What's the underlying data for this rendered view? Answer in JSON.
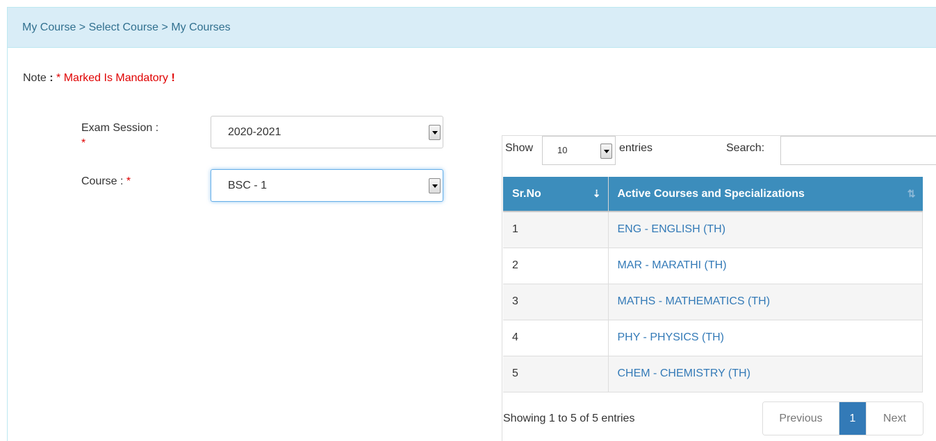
{
  "breadcrumb": "My Course > Select Course > My Courses",
  "note": {
    "prefix": "Note",
    "colon": ":",
    "asterisk": "*",
    "text": "Marked Is Mandatory",
    "bang": "!"
  },
  "form": {
    "exam_session_label": "Exam Session :",
    "exam_session_value": "2020-2021",
    "course_label": "Course :",
    "course_value": "BSC - 1",
    "required_mark": "*"
  },
  "datatable": {
    "show_label": "Show",
    "page_length": "10",
    "entries_label": "entries",
    "search_label": "Search:",
    "search_value": "",
    "columns": [
      "Sr.No",
      "Active Courses and Specializations"
    ],
    "rows": [
      {
        "sr": "1",
        "course": "ENG - ENGLISH (TH)"
      },
      {
        "sr": "2",
        "course": "MAR - MARATHI (TH)"
      },
      {
        "sr": "3",
        "course": "MATHS - MATHEMATICS (TH)"
      },
      {
        "sr": "4",
        "course": "PHY - PHYSICS (TH)"
      },
      {
        "sr": "5",
        "course": "CHEM - CHEMISTRY (TH)"
      }
    ],
    "info": "Showing 1 to 5 of 5 entries",
    "pagination": {
      "previous": "Previous",
      "current": "1",
      "next": "Next"
    }
  },
  "colors": {
    "header_bg": "#d9edf7",
    "table_header": "#3c8dbc",
    "link": "#337ab7",
    "required": "#e00000"
  }
}
